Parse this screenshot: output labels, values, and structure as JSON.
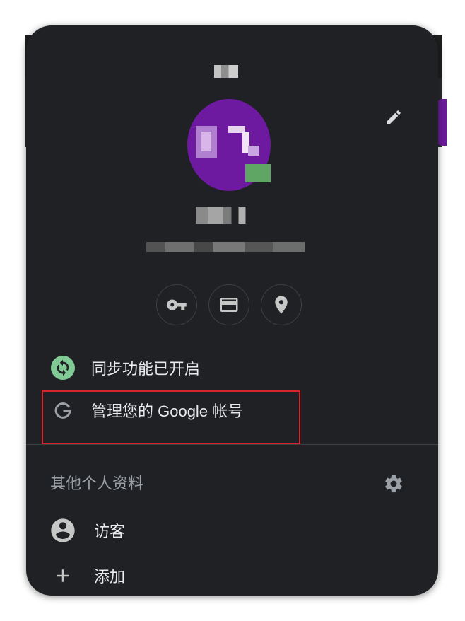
{
  "popup": {
    "edit_icon": "pencil-icon",
    "quick_actions": [
      {
        "name": "passwords",
        "icon": "key-icon"
      },
      {
        "name": "payment-methods",
        "icon": "credit-card-icon"
      },
      {
        "name": "addresses",
        "icon": "location-pin-icon"
      }
    ],
    "sync_label": "同步功能已开启",
    "manage_account_label": "管理您的 Google 帐号",
    "other_profiles_title": "其他个人资料",
    "guest_label": "访客",
    "add_label": "添加",
    "colors": {
      "background": "#202124",
      "text": "#e8eaed",
      "muted": "#9aa0a6",
      "sync_green": "#81c995",
      "highlight_red": "#d7262b",
      "avatar_purple": "#6d1aa0"
    }
  }
}
